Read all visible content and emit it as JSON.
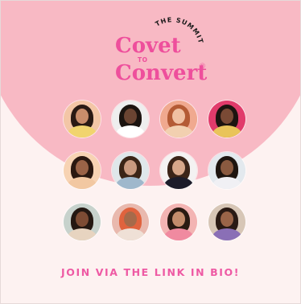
{
  "logo": {
    "line1": "Covet",
    "line2": "TO",
    "line3": "Convert",
    "badge": "THE SUMMIT",
    "registered": "®",
    "color": "#ee4f9c"
  },
  "cta": {
    "text": "JOIN VIA THE LINK IN BIO!",
    "color": "#ee5aa4"
  },
  "colors": {
    "background": "#fdf2f1",
    "circle": "#f8b9c4"
  },
  "speakers": [
    {
      "bg": "#f3c6a6",
      "hair": "#2a1a14",
      "skin": "#c98d6b",
      "top": "#f1d46e"
    },
    {
      "bg": "#eeeeee",
      "hair": "#1c1410",
      "skin": "#6b4432",
      "top": "#ffffff"
    },
    {
      "bg": "#f0a98f",
      "hair": "#b45b35",
      "skin": "#f0c0a2",
      "top": "#f2d0b0"
    },
    {
      "bg": "#e13b6b",
      "hair": "#1d1410",
      "skin": "#7a4a35",
      "top": "#e9c45a"
    },
    {
      "bg": "#f7d3b3",
      "hair": "#2a1810",
      "skin": "#9a6347",
      "top": "#f2c8a2"
    },
    {
      "bg": "#dfe7ea",
      "hair": "#3a2416",
      "skin": "#c99a7f",
      "top": "#9fb8cc"
    },
    {
      "bg": "#f4f2f2",
      "hair": "#3b2418",
      "skin": "#d7a78a",
      "top": "#1c1c2a"
    },
    {
      "bg": "#e3e9ee",
      "hair": "#1e1510",
      "skin": "#8a5a40",
      "top": "#f0f0f4"
    },
    {
      "bg": "#c7d2cc",
      "hair": "#241812",
      "skin": "#7d4c34",
      "top": "#e7d4c0"
    },
    {
      "bg": "#e9b9ae",
      "hair": "#e0633e",
      "skin": "#a66a4a",
      "top": "#efe0d6"
    },
    {
      "bg": "#f3b4b3",
      "hair": "#2a1a12",
      "skin": "#c48c6c",
      "top": "#f08aa0"
    },
    {
      "bg": "#d7c6b6",
      "hair": "#2a1a14",
      "skin": "#9a6448",
      "top": "#8a6fb6"
    }
  ]
}
